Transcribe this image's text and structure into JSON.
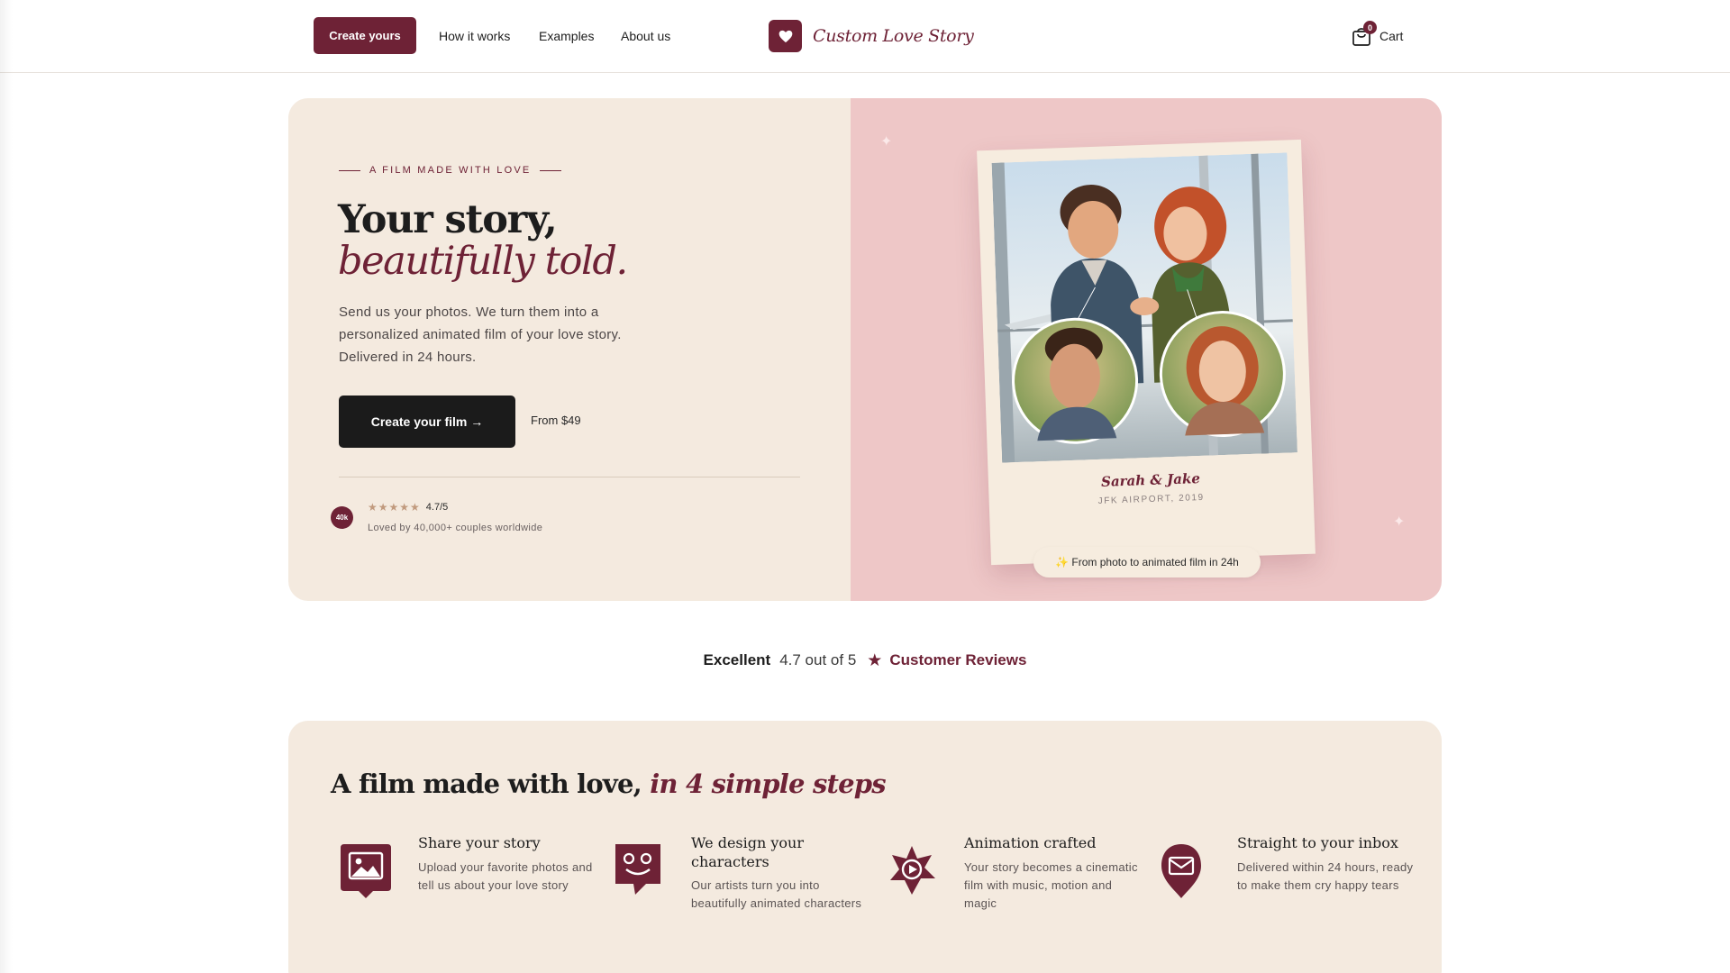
{
  "nav": {
    "cta_label": "Create yours",
    "links": [
      "How it works",
      "Examples",
      "About us"
    ],
    "brand_name": "Custom Love Story",
    "cart_label": "Cart",
    "cart_count": "0"
  },
  "hero": {
    "eyebrow": "A FILM MADE WITH LOVE",
    "title_line1": "Your story,",
    "title_line2": "beautifully told.",
    "description": "Send us your photos. We turn them into a personalized animated film of your love story. Delivered in 24 hours.",
    "cta_label": "Create your film →",
    "price_note": "From $49",
    "rating_badge": "40k",
    "stars": "★★★★★",
    "rating_score": "4.7/5",
    "rating_subtext": "Loved by 40,000+ couples worldwide",
    "polaroid_names": "Sarah & Jake",
    "polaroid_location": "JFK AIRPORT, 2019",
    "pill_text": "✨ From photo to animated film in 24h"
  },
  "reviews": {
    "label": "Excellent",
    "score": "4.7 out of 5",
    "link": "Customer Reviews"
  },
  "steps": {
    "title_prefix": "A film made with love, ",
    "title_accent": "in 4 simple steps",
    "items": [
      {
        "title": "Share your story",
        "description": "Upload your favorite photos and tell us about your love story",
        "icon": "photo-upload-icon"
      },
      {
        "title": "We design your characters",
        "description": "Our artists turn you into beautifully animated characters",
        "icon": "character-face-icon"
      },
      {
        "title": "Animation crafted",
        "description": "Your story becomes a cinematic film with music, motion and magic",
        "icon": "film-play-icon"
      },
      {
        "title": "Straight to your inbox",
        "description": "Delivered within 24 hours, ready to make them cry happy tears",
        "icon": "mail-pin-icon"
      }
    ]
  },
  "colors": {
    "brand": "#6e2236",
    "hero_left_bg": "#f4eadf",
    "hero_right_bg": "#eec7c7",
    "cta_dark": "#1b1b1b",
    "star": "#c19a7e"
  }
}
